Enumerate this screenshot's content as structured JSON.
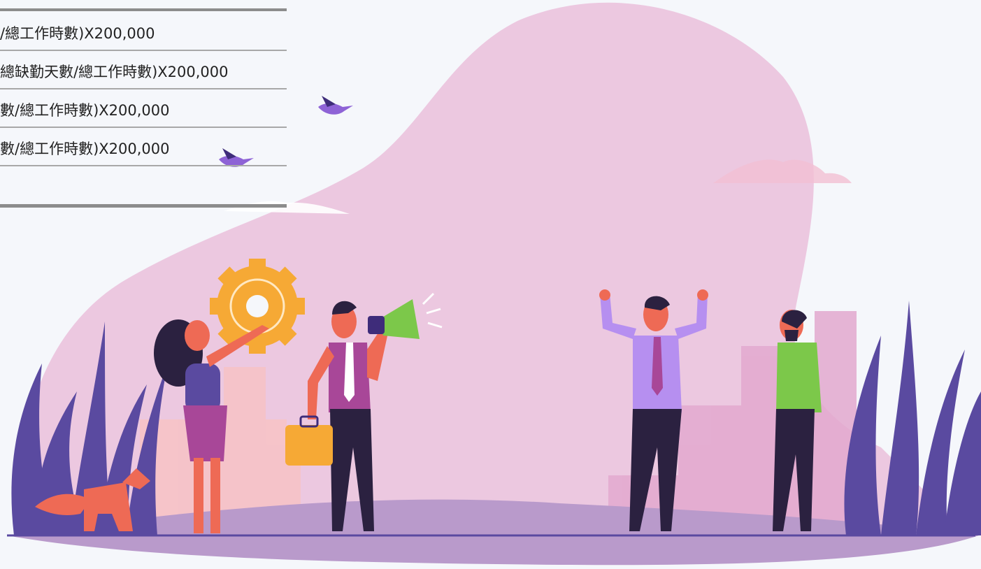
{
  "formula_rows": [
    {
      "text": "/總工作時數)X200,000"
    },
    {
      "text": "總缺勤天數/總工作時數)X200,000"
    },
    {
      "text": "數/總工作時數)X200,000"
    },
    {
      "text": "數/總工作時數)X200,000"
    }
  ],
  "colors": {
    "blob": "#ecc8e0",
    "ground": "#b99acb",
    "grass": "#5a4aa0",
    "gear": "#f6a935",
    "megaphone": "#7cc84a",
    "bird": "#8e63d6"
  },
  "illustration_icons": [
    "bird-icon",
    "gear-icon",
    "megaphone-icon",
    "briefcase-icon",
    "fox-icon"
  ]
}
